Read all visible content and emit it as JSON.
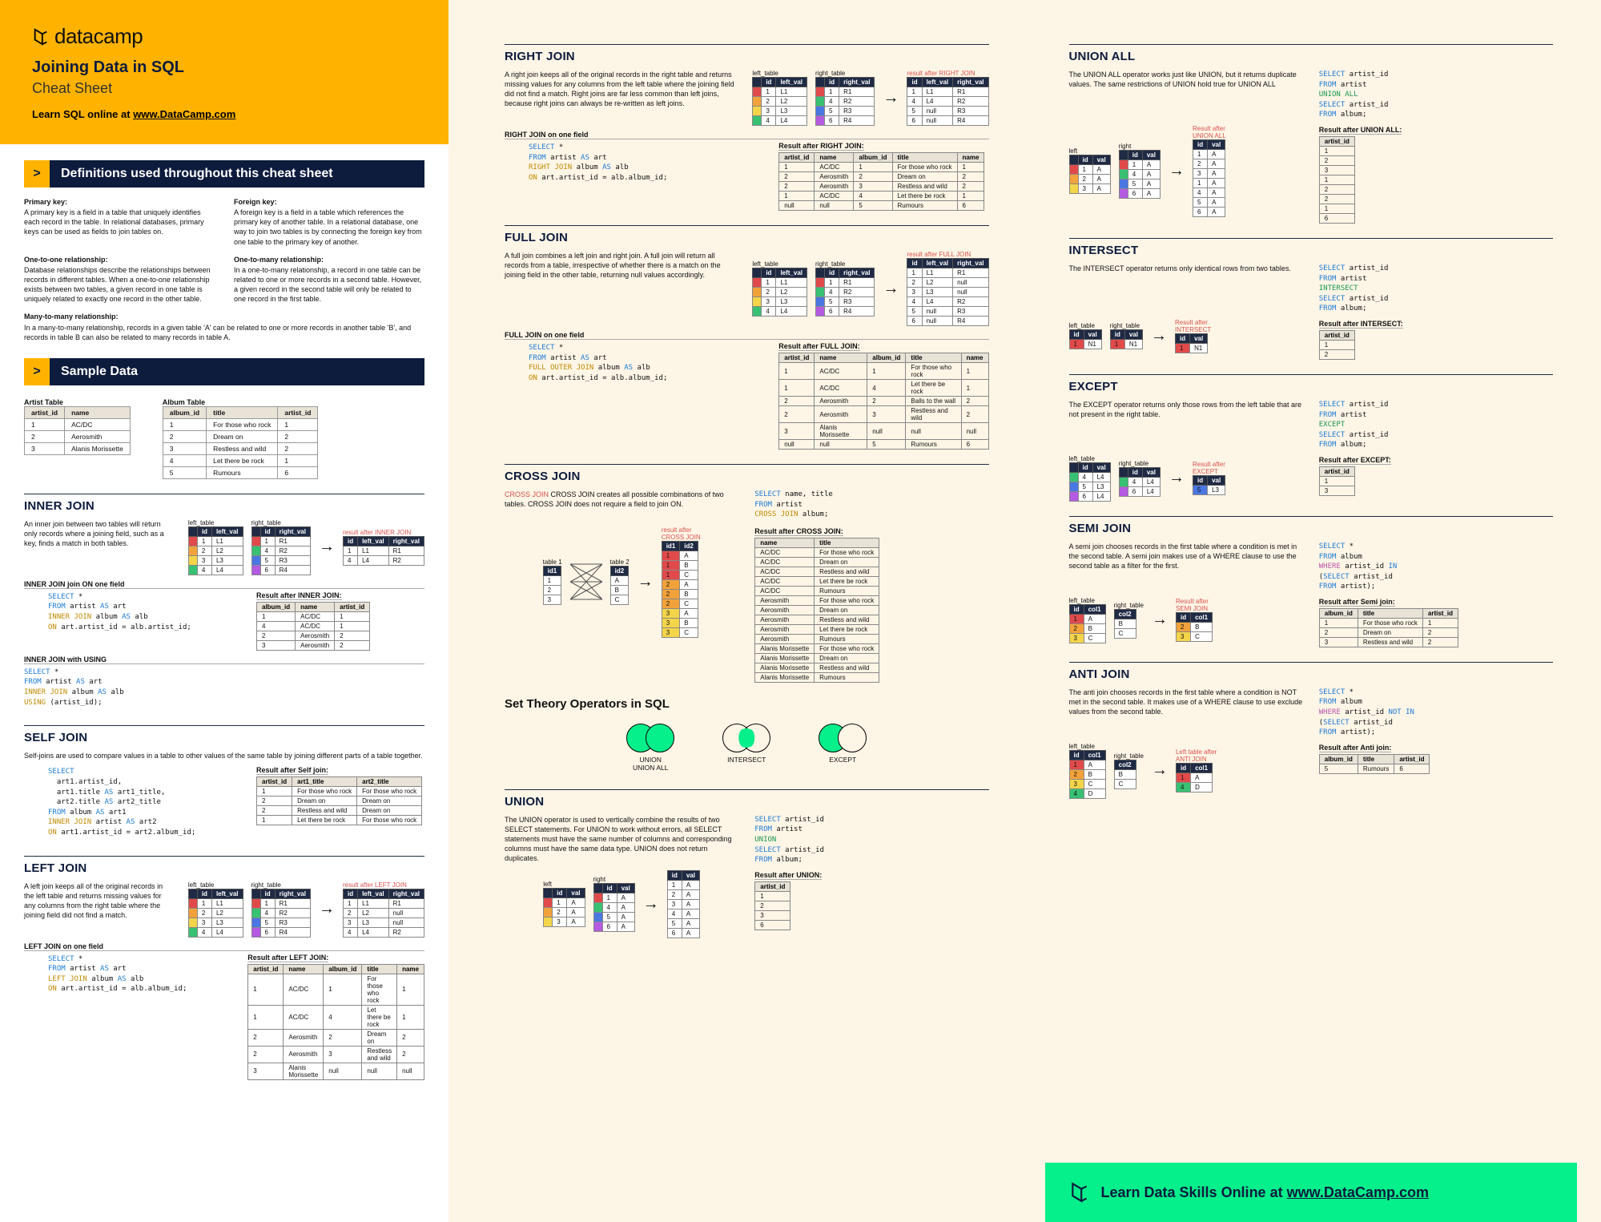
{
  "brand": "datacamp",
  "title": "Joining Data in SQL",
  "subtitle": "Cheat Sheet",
  "learn_line_pre": "Learn SQL online at ",
  "learn_link": "www.DataCamp.com",
  "bars": {
    "definitions": "Definitions used throughout this cheat sheet",
    "sample": "Sample Data"
  },
  "definitions": {
    "pk_term": "Primary key:",
    "pk_body": "A primary key is a field in a table that uniquely identifies each record in the table. In relational databases, primary keys can be used as fields to join tables on.",
    "fk_term": "Foreign key:",
    "fk_body": "A foreign key is a field in a table which references the primary key of another table. In a relational database, one way to join two tables is by connecting the foreign key from one table to the primary key of another.",
    "o2o_term": "One-to-one relationship:",
    "o2o_body": "Database relationships describe the relationships between records in different tables. When a one-to-one relationship exists between two tables, a given record in one table is uniquely related to exactly one record in the other table.",
    "o2m_term": "One-to-many relationship:",
    "o2m_body": "In a one-to-many relationship, a record in one table can be related to one or more records in a second table. However, a given record in the second table will only be related to one record in the first table.",
    "m2m_term": "Many-to-many relationship:",
    "m2m_body": "In a many-to-many relationship, records in a given table 'A' can be related to one or more records in another table 'B', and records in table B can also be related to many records in table A."
  },
  "sample": {
    "artist_caption": "Artist Table",
    "album_caption": "Album Table",
    "artist_cols": [
      "artist_id",
      "name"
    ],
    "artist_rows": [
      [
        "1",
        "AC/DC"
      ],
      [
        "2",
        "Aerosmith"
      ],
      [
        "3",
        "Alanis Morissette"
      ]
    ],
    "album_cols": [
      "album_id",
      "title",
      "artist_id"
    ],
    "album_rows": [
      [
        "1",
        "For those who rock",
        "1"
      ],
      [
        "2",
        "Dream on",
        "2"
      ],
      [
        "3",
        "Restless and wild",
        "2"
      ],
      [
        "4",
        "Let there be rock",
        "1"
      ],
      [
        "5",
        "Rumours",
        "6"
      ]
    ]
  },
  "inner": {
    "h": "INNER JOIN",
    "desc": "An inner join between two tables will return only records where a joining field, such as a key, finds a match in both tables.",
    "sub1": "INNER JOIN join ON one field",
    "code1": "SELECT *\nFROM artist AS art\nINNER JOIN album AS alb\nON art.artist_id = alb.artist_id;",
    "sub2": "INNER JOIN with USING",
    "code2": "SELECT *\nFROM artist AS art\nINNER JOIN album AS alb\nUSING (artist_id);",
    "res_label": "Result after INNER JOIN:",
    "res_cols": [
      "album_id",
      "name",
      "artist_id"
    ],
    "res_rows": [
      [
        "1",
        "AC/DC",
        "1"
      ],
      [
        "4",
        "AC/DC",
        "1"
      ],
      [
        "2",
        "Aerosmith",
        "2"
      ],
      [
        "3",
        "Aerosmith",
        "2"
      ]
    ],
    "diag_res_label": "result after INNER JOIN"
  },
  "self": {
    "h": "SELF JOIN",
    "desc": "Self-joins are used to compare values in a table to other values of the same table by joining different parts of a table together.",
    "code": "SELECT\n  art1.artist_id,\n  art1.title AS art1_title,\n  art2.title AS art2_title\nFROM album AS art1\nINNER JOIN artist AS art2\nON art1.artist_id = art2.album_id;",
    "res_label": "Result after Self join:",
    "res_cols": [
      "artist_id",
      "art1_title",
      "art2_title"
    ],
    "res_rows": [
      [
        "1",
        "For those who rock",
        "For those who rock"
      ],
      [
        "2",
        "Dream on",
        "Dream on"
      ],
      [
        "2",
        "Restless and wild",
        "Dream on"
      ],
      [
        "1",
        "Let there be rock",
        "For those who rock"
      ]
    ]
  },
  "left": {
    "h": "LEFT JOIN",
    "desc": "A left join keeps all of the original records in the left table and returns missing values for any columns from the right table where the joining field did not find a match.",
    "sub": "LEFT JOIN on one field",
    "code": "SELECT *\nFROM artist AS art\nLEFT JOIN album AS alb\nON art.artist_id = alb.album_id;",
    "res_label": "Result after LEFT JOIN:",
    "res_cols": [
      "artist_id",
      "name",
      "album_id",
      "title",
      "name"
    ],
    "res_rows": [
      [
        "1",
        "AC/DC",
        "1",
        "For those who rock",
        "1"
      ],
      [
        "1",
        "AC/DC",
        "4",
        "Let there be rock",
        "1"
      ],
      [
        "2",
        "Aerosmith",
        "2",
        "Dream on",
        "2"
      ],
      [
        "2",
        "Aerosmith",
        "3",
        "Restless and wild",
        "2"
      ],
      [
        "3",
        "Alanis Morissette",
        "null",
        "null",
        "null"
      ]
    ],
    "diag_res_label": "result after LEFT JOIN"
  },
  "right": {
    "h": "RIGHT JOIN",
    "desc": "A right join keeps all of the original records in the right table and returns missing values for any columns from the left table where the joining field did not find a match. Right joins are far less common than left joins, because right joins can always be re-written as left joins.",
    "sub": "RIGHT JOIN on one field",
    "code": "SELECT *\nFROM artist AS art\nRIGHT JOIN album AS alb\nON art.artist_id = alb.album_id;",
    "res_label": "Result after RIGHT JOIN:",
    "res_cols": [
      "artist_id",
      "name",
      "album_id",
      "title",
      "name"
    ],
    "res_rows": [
      [
        "1",
        "AC/DC",
        "1",
        "For those who rock",
        "1"
      ],
      [
        "2",
        "Aerosmith",
        "2",
        "Dream on",
        "2"
      ],
      [
        "2",
        "Aerosmith",
        "3",
        "Restless and wild",
        "2"
      ],
      [
        "1",
        "AC/DC",
        "4",
        "Let there be rock",
        "1"
      ],
      [
        "null",
        "null",
        "5",
        "Rumours",
        "6"
      ]
    ],
    "diag_res_label": "result after RIGHT JOIN"
  },
  "full": {
    "h": "FULL JOIN",
    "desc": "A full join combines a left join and right join. A full join will return all records from a table, irrespective of whether there is a match on the joining field in the other table, returning null values accordingly.",
    "sub": "FULL JOIN on one field",
    "code": "SELECT *\nFROM artist AS art\nFULL OUTER JOIN album AS alb\nON art.artist_id = alb.album_id;",
    "res_label": "Result after FULL JOIN:",
    "res_cols": [
      "artist_id",
      "name",
      "album_id",
      "title",
      "name"
    ],
    "res_rows": [
      [
        "1",
        "AC/DC",
        "1",
        "For those who rock",
        "1"
      ],
      [
        "1",
        "AC/DC",
        "4",
        "Let there be rock",
        "1"
      ],
      [
        "2",
        "Aerosmith",
        "2",
        "Balls to the wall",
        "2"
      ],
      [
        "2",
        "Aerosmith",
        "3",
        "Restless and wild",
        "2"
      ],
      [
        "3",
        "Alanis Morissette",
        "null",
        "null",
        "null"
      ],
      [
        "null",
        "null",
        "5",
        "Rumours",
        "6"
      ]
    ],
    "diag_res_label": "result after FULL JOIN"
  },
  "cross": {
    "h": "CROSS JOIN",
    "desc": "CROSS JOIN creates all possible combinations of two tables. CROSS JOIN does not require a field to join ON.",
    "code": "SELECT name, title\nFROM artist\nCROSS JOIN album;",
    "res_label": "Result after CROSS JOIN:",
    "res_cols": [
      "name",
      "title"
    ],
    "res_rows": [
      [
        "AC/DC",
        "For those who rock"
      ],
      [
        "AC/DC",
        "Dream on"
      ],
      [
        "AC/DC",
        "Restless and wild"
      ],
      [
        "AC/DC",
        "Let there be rock"
      ],
      [
        "AC/DC",
        "Rumours"
      ],
      [
        "Aerosmith",
        "For those who rock"
      ],
      [
        "Aerosmith",
        "Dream on"
      ],
      [
        "Aerosmith",
        "Restless and wild"
      ],
      [
        "Aerosmith",
        "Let there be rock"
      ],
      [
        "Aerosmith",
        "Rumours"
      ],
      [
        "Alanis Morissette",
        "For those who rock"
      ],
      [
        "Alanis Morissette",
        "Dream on"
      ],
      [
        "Alanis Morissette",
        "Restless and wild"
      ],
      [
        "Alanis Morissette",
        "Rumours"
      ]
    ],
    "diag_label": "result after\nCROSS JOIN"
  },
  "setops_h": "Set Theory Operators in SQL",
  "venn": {
    "union": "UNION",
    "union_all": "UNION ALL",
    "intersect": "INTERSECT",
    "except": "EXCEPT"
  },
  "union": {
    "h": "UNION",
    "desc": "The UNION operator is used to vertically combine the results of two SELECT statements. For UNION to work without errors, all SELECT statements must have the same number of columns and corresponding columns must have the same data type. UNION does not return duplicates.",
    "code": "SELECT artist_id\nFROM artist\nUNION\nSELECT artist_id\nFROM album;",
    "res_label": "Result after UNION:",
    "res_cols": [
      "artist_id"
    ],
    "res_rows": [
      [
        "1"
      ],
      [
        "2"
      ],
      [
        "3"
      ],
      [
        "6"
      ]
    ],
    "diag_left": "left",
    "diag_right": "right"
  },
  "union_all": {
    "h": "UNION ALL",
    "desc": "The UNION ALL operator works just like UNION, but it returns duplicate values. The same restrictions of UNION hold true for UNION ALL",
    "code": "SELECT artist_id\nFROM artist\nUNION ALL\nSELECT artist_id\nFROM album;",
    "res_label": "Result after UNION ALL:",
    "res_cols": [
      "artist_id"
    ],
    "res_rows": [
      [
        "1"
      ],
      [
        "2"
      ],
      [
        "3"
      ],
      [
        "1"
      ],
      [
        "2"
      ],
      [
        "2"
      ],
      [
        "1"
      ],
      [
        "6"
      ]
    ],
    "diag_label": "Result after\nUNION ALL",
    "diag_left": "left",
    "diag_right": "right"
  },
  "intersect": {
    "h": "INTERSECT",
    "desc": "The INTERSECT operator returns only identical rows from two tables.",
    "code": "SELECT artist_id\nFROM artist\nINTERSECT\nSELECT artist_id\nFROM album;",
    "res_label": "Result after INTERSECT:",
    "res_cols": [
      "artist_id"
    ],
    "res_rows": [
      [
        "1"
      ],
      [
        "2"
      ]
    ],
    "diag_label": "Result after\nINTERSECT",
    "lt": "left_table",
    "rt": "right_table"
  },
  "except": {
    "h": "EXCEPT",
    "desc": "The EXCEPT operator returns only those rows from the left table that are not present in the right table.",
    "code": "SELECT artist_id\nFROM artist\nEXCEPT\nSELECT artist_id\nFROM album;",
    "res_label": "Result after EXCEPT:",
    "res_cols": [
      "artist_id"
    ],
    "res_rows": [
      [
        "1"
      ],
      [
        "3"
      ]
    ],
    "diag_label": "Result after\nEXCEPT",
    "lt": "left_table",
    "rt": "right_table"
  },
  "semi": {
    "h": "SEMI JOIN",
    "desc": "A semi join chooses records in the first table where a condition is met in the second table. A semi join makes use of a WHERE clause to use the second table as a filter for the first.",
    "code": "SELECT *\nFROM album\nWHERE artist_id IN\n(SELECT artist_id\nFROM artist);",
    "res_label": "Result after Semi join:",
    "res_cols": [
      "album_id",
      "title",
      "artist_id"
    ],
    "res_rows": [
      [
        "1",
        "For those who rock",
        "1"
      ],
      [
        "2",
        "Dream on",
        "2"
      ],
      [
        "3",
        "Restless and wild",
        "2"
      ]
    ],
    "diag_label": "Result after\nSEMI JOIN",
    "lt": "left_table",
    "rt": "right_table"
  },
  "anti": {
    "h": "ANTI JOIN",
    "desc": "The anti join chooses records in the first table where a condition is NOT met in the second table. It makes use of a WHERE clause to use exclude values from the second table.",
    "code": "SELECT *\nFROM album\nWHERE artist_id NOT IN\n(SELECT artist_id\nFROM artist);",
    "res_label": "Result after Anti join:",
    "res_cols": [
      "album_id",
      "title",
      "artist_id"
    ],
    "res_rows": [
      [
        "5",
        "Rumours",
        "6"
      ]
    ],
    "diag_label": "Left table after\nANTI JOIN",
    "lt": "left_table",
    "rt": "right_table"
  },
  "footer_pre": "Learn Data Skills Online at ",
  "footer_link": "www.DataCamp.com",
  "labels": {
    "left_table": "left_table",
    "right_table": "right_table",
    "id": "id",
    "left_val": "left_val",
    "right_val": "right_val",
    "val": "val",
    "table1": "table 1",
    "table2": "table 2",
    "id1": "id1",
    "id2": "id2",
    "col1": "col1",
    "col2": "col2"
  }
}
